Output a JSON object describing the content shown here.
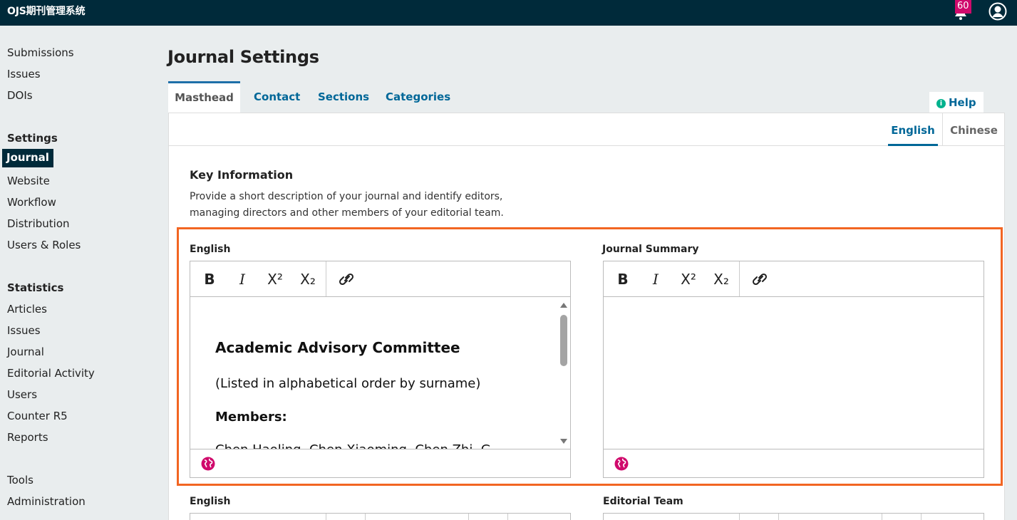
{
  "app": {
    "brand": "OJS期刊管理系统",
    "notifications_count": "60"
  },
  "sidebar": {
    "main_items": [
      "Submissions",
      "Issues",
      "DOIs"
    ],
    "settings_heading": "Settings",
    "settings_items": [
      "Journal",
      "Website",
      "Workflow",
      "Distribution",
      "Users & Roles"
    ],
    "active_item": "Journal",
    "statistics_heading": "Statistics",
    "statistics_items": [
      "Articles",
      "Issues",
      "Journal",
      "Editorial Activity",
      "Users",
      "Counter R5",
      "Reports"
    ],
    "tools_items": [
      "Tools",
      "Administration"
    ]
  },
  "page": {
    "title": "Journal Settings",
    "tabs": [
      "Masthead",
      "Contact",
      "Sections",
      "Categories"
    ],
    "active_tab": "Masthead",
    "help_label": "Help"
  },
  "locales": {
    "items": [
      "English",
      "Chinese"
    ],
    "active": "English"
  },
  "key_info": {
    "title": "Key Information",
    "description": "Provide a short description of your journal and identify editors, managing directors and other members of your editorial team."
  },
  "editors": {
    "left_label": "English",
    "right_label": "Journal Summary",
    "toolbar": [
      "B",
      "I",
      "X²",
      "X₂",
      "link"
    ],
    "left_content": {
      "heading": "Academic Advisory Committee",
      "note": "(Listed in alphabetical order by surname)",
      "members_label": "Members:",
      "cut_line": "Chen Haoling, Chen Xiaoming, Chen Zhi, G..."
    },
    "right_content": ""
  },
  "lower_fields": {
    "left_label": "English",
    "right_label": "Editorial Team"
  },
  "colors": {
    "topbar": "#002a3a",
    "link": "#006798",
    "highlight": "#f26522",
    "badge": "#d00a6c"
  }
}
